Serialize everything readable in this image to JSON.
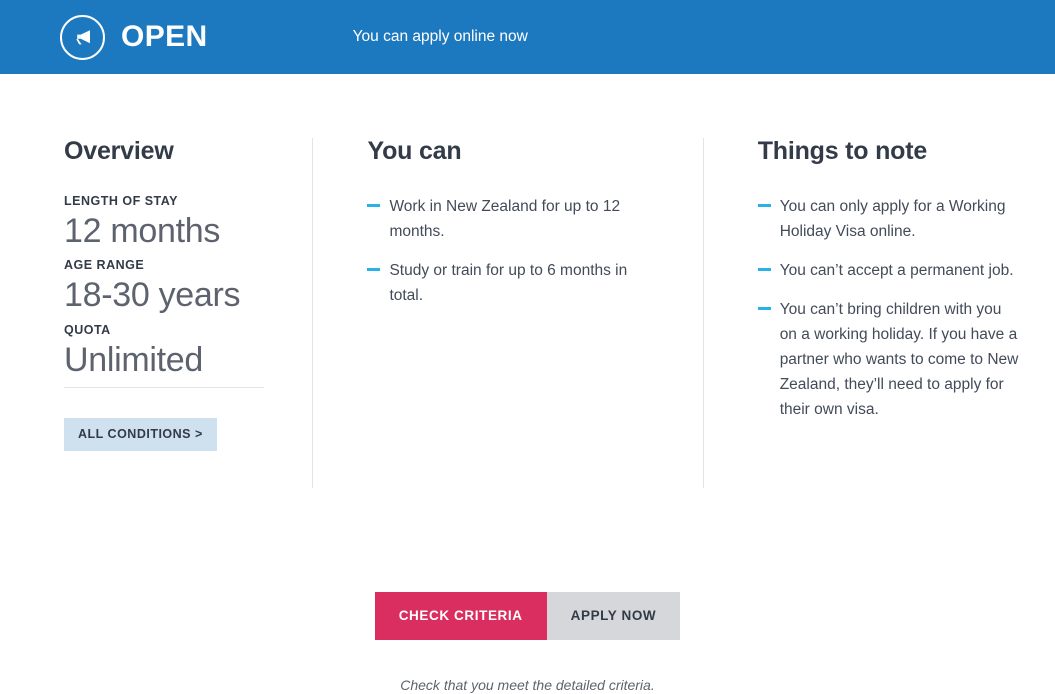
{
  "banner": {
    "icon": "megaphone-icon",
    "status": "OPEN",
    "note": "You can apply online now",
    "background_color": "#1d79bf"
  },
  "overview": {
    "title": "Overview",
    "facts": [
      {
        "label": "LENGTH OF STAY",
        "value": "12 months"
      },
      {
        "label": "AGE RANGE",
        "value": "18-30 years"
      },
      {
        "label": "QUOTA",
        "value": "Unlimited"
      }
    ],
    "conditions_button": "ALL CONDITIONS >",
    "conditions_button_color": "#cfe1ee"
  },
  "you_can": {
    "title": "You can",
    "bullets": [
      "Work in New Zealand for up to 12 months.",
      "Study or train for up to 6 months in total."
    ]
  },
  "things_to_note": {
    "title": "Things to note",
    "bullets": [
      "You can only apply for a Working Holiday Visa online.",
      "You can’t accept a permanent job.",
      "You can’t bring children with you on a working holiday. If you have a partner who wants to come to New Zealand, they’ll need to apply for their own visa."
    ]
  },
  "actions": {
    "primary_label": "CHECK CRITERIA",
    "secondary_label": "APPLY NOW",
    "caption": "Check that you meet the detailed criteria.",
    "primary_color": "#d92e5f",
    "secondary_color": "#d5d7da"
  },
  "accent_colors": {
    "bullet_dash": "#29b2e6",
    "heading": "#333a48",
    "divider": "#e3e3e5"
  }
}
